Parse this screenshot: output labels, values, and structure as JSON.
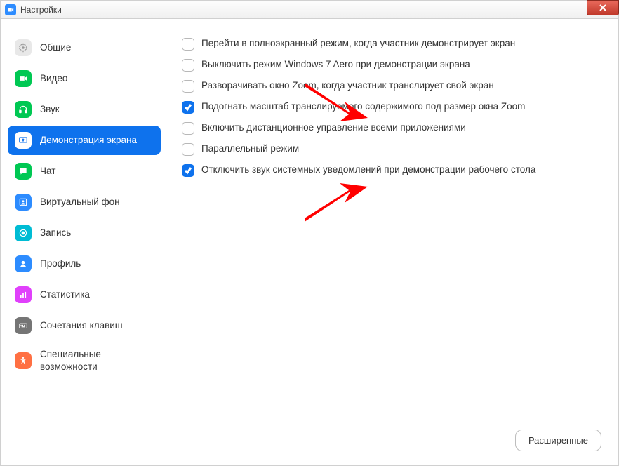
{
  "window": {
    "title": "Настройки"
  },
  "sidebar": {
    "items": [
      {
        "key": "general",
        "label": "Общие"
      },
      {
        "key": "video",
        "label": "Видео"
      },
      {
        "key": "audio",
        "label": "Звук"
      },
      {
        "key": "share",
        "label": "Демонстрация экрана",
        "active": true
      },
      {
        "key": "chat",
        "label": "Чат"
      },
      {
        "key": "vbg",
        "label": "Виртуальный фон"
      },
      {
        "key": "record",
        "label": "Запись"
      },
      {
        "key": "profile",
        "label": "Профиль"
      },
      {
        "key": "stats",
        "label": "Статистика"
      },
      {
        "key": "keys",
        "label": "Сочетания клавиш"
      },
      {
        "key": "access",
        "label": "Специальные возможности"
      }
    ]
  },
  "options": [
    {
      "label": "Перейти в полноэкранный режим, когда участник демонстрирует экран",
      "checked": false
    },
    {
      "label": "Выключить режим Windows 7 Aero при демонстрации экрана",
      "checked": false
    },
    {
      "label": "Разворачивать окно Zoom, когда участник транслирует свой экран",
      "checked": false
    },
    {
      "label": "Подогнать масштаб транслируемого содержимого под размер окна Zoom",
      "checked": true
    },
    {
      "label": "Включить дистанционное управление всеми приложениями",
      "checked": false
    },
    {
      "label": "Параллельный режим",
      "checked": false
    },
    {
      "label": "Отключить звук системных уведомлений при демонстрации рабочего стола",
      "checked": true
    }
  ],
  "buttons": {
    "advanced": "Расширенные"
  },
  "annotations": {
    "arrows_point_to_option_indices": [
      3,
      6
    ]
  }
}
